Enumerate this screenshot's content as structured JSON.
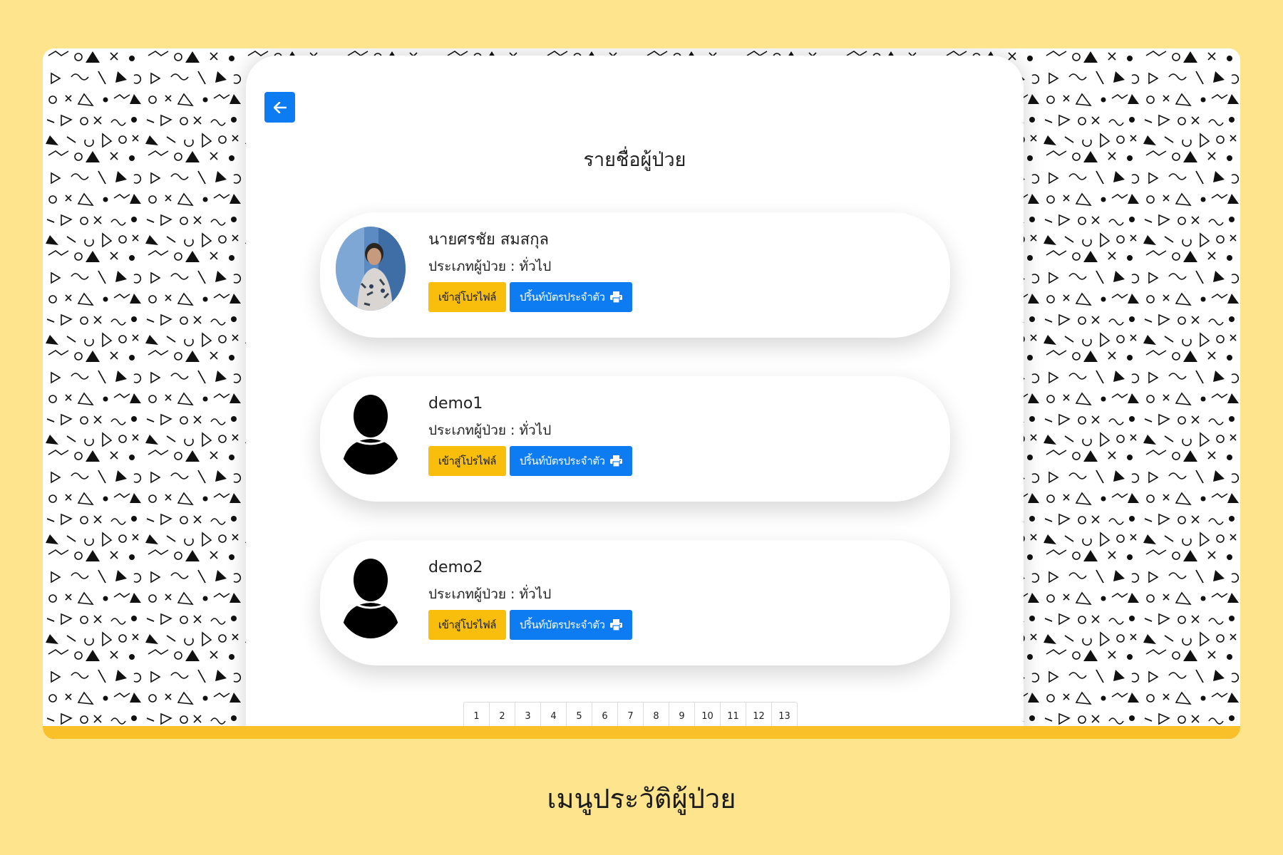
{
  "page": {
    "background_color": "#fde48d",
    "accent_bar_color": "#f9c02a",
    "caption": "เมนูประวัติผู้ป่วย"
  },
  "header": {
    "back_icon": "arrow-left-icon",
    "title": "รายชื่อผู้ป่วย"
  },
  "patients": [
    {
      "name": "นายศรชัย สมสกุล",
      "type_text": "ประเภทผู้ป่วย : ทั่วไป",
      "avatar": "photo",
      "profile_label": "เข้าสู่โปรไฟล์",
      "print_label": "ปริ้นท์บัตรประจำตัว",
      "print_icon": "printer-icon"
    },
    {
      "name": "demo1",
      "type_text": "ประเภทผู้ป่วย : ทั่วไป",
      "avatar": "user-silhouette-icon",
      "profile_label": "เข้าสู่โปรไฟล์",
      "print_label": "ปริ้นท์บัตรประจำตัว",
      "print_icon": "printer-icon"
    },
    {
      "name": "demo2",
      "type_text": "ประเภทผู้ป่วย : ทั่วไป",
      "avatar": "user-silhouette-icon",
      "profile_label": "เข้าสู่โปรไฟล์",
      "print_label": "ปริ้นท์บัตรประจำตัว",
      "print_icon": "printer-icon"
    }
  ],
  "pagination": {
    "pages": [
      "1",
      "2",
      "3",
      "4",
      "5",
      "6",
      "7",
      "8",
      "9",
      "10",
      "11",
      "12",
      "13"
    ]
  },
  "colors": {
    "primary": "#0d7cf2",
    "warning": "#f8be0b"
  }
}
